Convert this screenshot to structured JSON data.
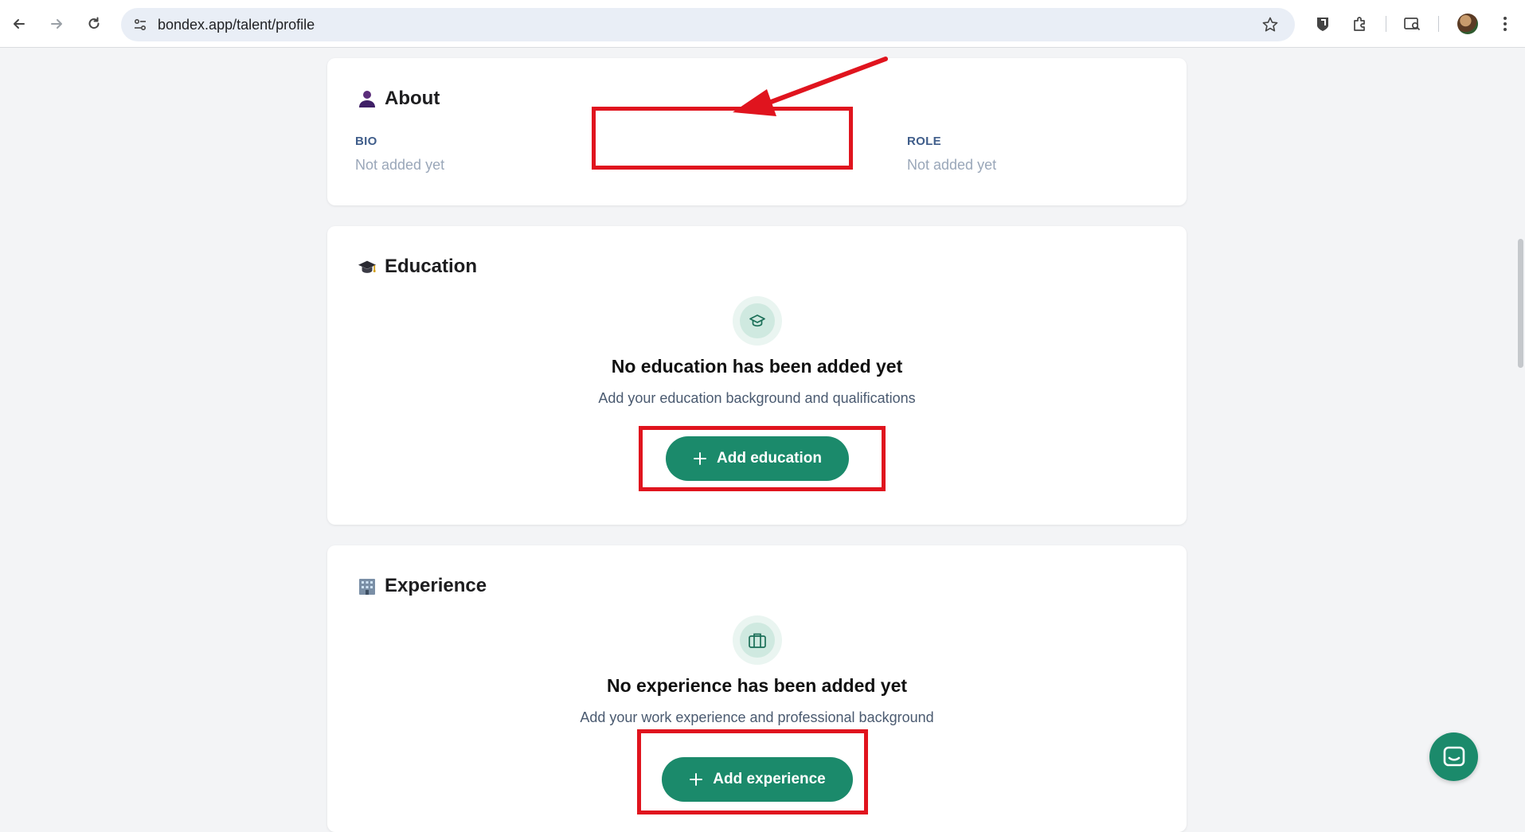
{
  "browser": {
    "url": "bondex.app/talent/profile"
  },
  "about": {
    "title": "About",
    "bio_label": "BIO",
    "bio_value": "Not added yet",
    "role_label": "ROLE",
    "role_value": "Not added yet"
  },
  "education": {
    "title": "Education",
    "empty_title": "No education has been added yet",
    "empty_subtitle": "Add your education background and qualifications",
    "add_button": "Add education"
  },
  "experience": {
    "title": "Experience",
    "empty_title": "No experience has been added yet",
    "empty_subtitle": "Add your work experience and professional background",
    "add_button": "Add experience"
  },
  "colors": {
    "accent": "#1b8a6b",
    "annotation": "#e0141e"
  }
}
